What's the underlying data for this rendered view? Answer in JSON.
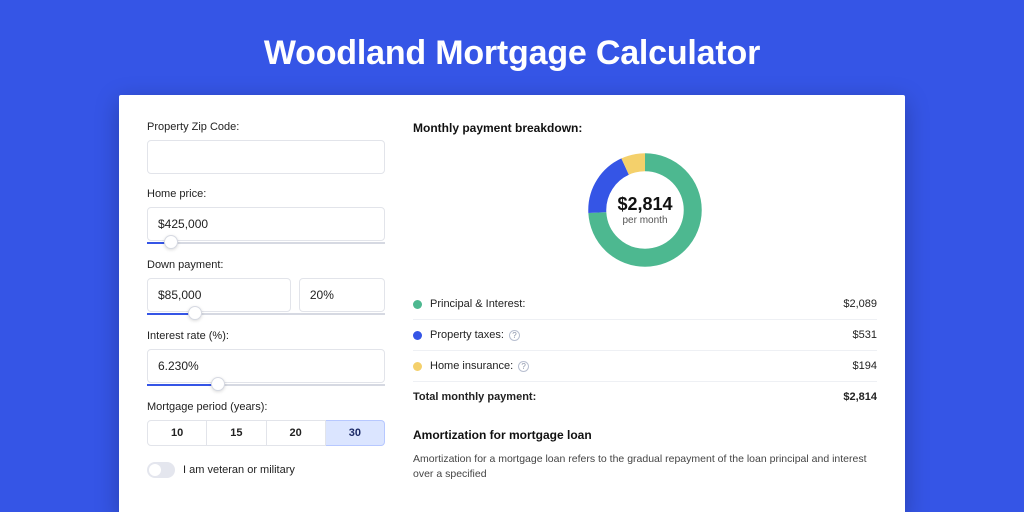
{
  "title": "Woodland Mortgage Calculator",
  "form": {
    "zip": {
      "label": "Property Zip Code:",
      "value": ""
    },
    "price": {
      "label": "Home price:",
      "value": "$425,000",
      "slider_pct": 10
    },
    "down": {
      "label": "Down payment:",
      "amount": "$85,000",
      "percent": "20%",
      "slider_pct": 20
    },
    "rate": {
      "label": "Interest rate (%):",
      "value": "6.230%",
      "slider_pct": 30
    },
    "period": {
      "label": "Mortgage period (years):",
      "options": [
        "10",
        "15",
        "20",
        "30"
      ],
      "selected": "30"
    },
    "veteran": {
      "label": "I am veteran or military",
      "on": false
    }
  },
  "breakdown": {
    "heading": "Monthly payment breakdown:",
    "center_value": "$2,814",
    "center_sub": "per month",
    "items": [
      {
        "name": "Principal & Interest:",
        "value": "$2,089",
        "color": "#4db890",
        "pct": 74
      },
      {
        "name": "Property taxes:",
        "value": "$531",
        "color": "#3555e6",
        "pct": 19,
        "help": true
      },
      {
        "name": "Home insurance:",
        "value": "$194",
        "color": "#f4d06b",
        "pct": 7,
        "help": true
      }
    ],
    "total": {
      "name": "Total monthly payment:",
      "value": "$2,814"
    }
  },
  "amortization": {
    "heading": "Amortization for mortgage loan",
    "text": "Amortization for a mortgage loan refers to the gradual repayment of the loan principal and interest over a specified"
  },
  "chart_data": {
    "type": "pie",
    "title": "Monthly payment breakdown",
    "categories": [
      "Principal & Interest",
      "Property taxes",
      "Home insurance"
    ],
    "values": [
      2089,
      531,
      194
    ],
    "total": 2814,
    "colors": [
      "#4db890",
      "#3555e6",
      "#f4d06b"
    ]
  }
}
